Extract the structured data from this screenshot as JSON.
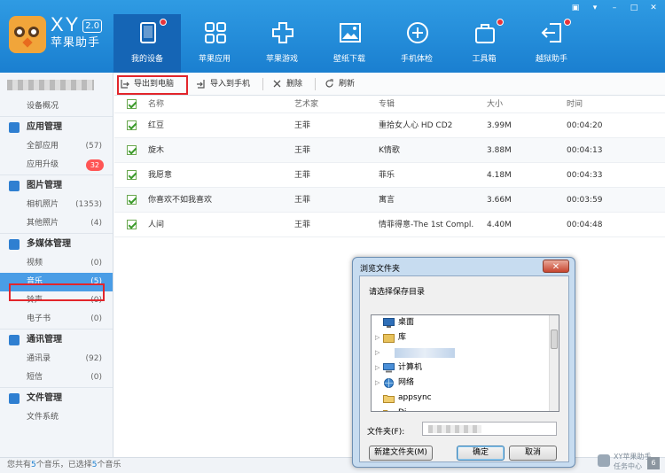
{
  "app": {
    "brand": "XY",
    "version": "2.0",
    "name_cn": "苹果助手"
  },
  "nav": [
    {
      "label": "我的设备",
      "icon": "tablet-icon",
      "active": true,
      "dot": true
    },
    {
      "label": "苹果应用",
      "icon": "apps-grid-icon",
      "active": false,
      "dot": false
    },
    {
      "label": "苹果游戏",
      "icon": "gamepad-icon",
      "active": false,
      "dot": false
    },
    {
      "label": "壁纸下载",
      "icon": "picture-icon",
      "active": false,
      "dot": false
    },
    {
      "label": "手机体检",
      "icon": "plus-circle-icon",
      "active": false,
      "dot": false
    },
    {
      "label": "工具箱",
      "icon": "toolbox-icon",
      "active": false,
      "dot": true
    },
    {
      "label": "越狱助手",
      "icon": "exit-arrow-icon",
      "active": false,
      "dot": true
    }
  ],
  "window": {
    "skin": "▣",
    "menu": "▾",
    "minimize": "–",
    "maximize": "□",
    "close": "✕"
  },
  "sidebar": {
    "overview": "设备概况",
    "groups": [
      {
        "title": "应用管理",
        "items": [
          {
            "label": "全部应用",
            "count": "(57)"
          },
          {
            "label": "应用升级",
            "badge": "32"
          }
        ]
      },
      {
        "title": "图片管理",
        "items": [
          {
            "label": "相机照片",
            "count": "(1353)"
          },
          {
            "label": "其他照片",
            "count": "(4)"
          }
        ]
      },
      {
        "title": "多媒体管理",
        "items": [
          {
            "label": "视频",
            "count": "(0)"
          },
          {
            "label": "音乐",
            "count": "(5)"
          },
          {
            "label": "铃声",
            "count": "(0)"
          },
          {
            "label": "电子书",
            "count": "(0)"
          }
        ]
      },
      {
        "title": "通讯管理",
        "items": [
          {
            "label": "通讯录",
            "count": "(92)"
          },
          {
            "label": "短信",
            "count": "(0)"
          }
        ]
      },
      {
        "title": "文件管理",
        "items": [
          {
            "label": "文件系统",
            "count": ""
          }
        ]
      }
    ]
  },
  "toolbar": {
    "export_pc": "导出到电脑",
    "import_phone": "导入到手机",
    "delete": "删除",
    "refresh": "刷新"
  },
  "table": {
    "headers": [
      "名称",
      "艺术家",
      "专辑",
      "大小",
      "时间"
    ],
    "rows": [
      {
        "name": "红豆",
        "artist": "王菲",
        "album": "重拾女人心 HD CD2",
        "size": "3.99M",
        "time": "00:04:20"
      },
      {
        "name": "旋木",
        "artist": "王菲",
        "album": "K情歌",
        "size": "3.88M",
        "time": "00:04:13"
      },
      {
        "name": "我愿意",
        "artist": "王菲",
        "album": "菲乐",
        "size": "4.18M",
        "time": "00:04:33"
      },
      {
        "name": "你喜欢不如我喜欢",
        "artist": "王菲",
        "album": "寓言",
        "size": "3.66M",
        "time": "00:03:59"
      },
      {
        "name": "人间",
        "artist": "王菲",
        "album": "情菲得意-The 1st Compl.",
        "size": "4.40M",
        "time": "00:04:48"
      }
    ]
  },
  "status": {
    "prefix": "您共有",
    "total": "5",
    "mid": "个音乐，已选择",
    "selected": "5",
    "suffix": "个音乐"
  },
  "dialog": {
    "title": "浏览文件夹",
    "close": "✕",
    "prompt": "请选择保存目录",
    "tree": [
      {
        "label": "桌面",
        "expander": ""
      },
      {
        "label": "库",
        "expander": "▷"
      },
      {
        "label": "",
        "expander": "▷"
      },
      {
        "label": "计算机",
        "expander": "▷"
      },
      {
        "label": "网络",
        "expander": "▷"
      },
      {
        "label": "appsync",
        "expander": ""
      },
      {
        "label": "Di",
        "expander": ""
      }
    ],
    "folder_label": "文件夹(F):",
    "new_folder": "新建文件夹(M)",
    "ok": "确定",
    "cancel": "取消"
  },
  "corner": {
    "brand": "XY苹果助手",
    "sub": "任务中心",
    "badge": "6"
  }
}
